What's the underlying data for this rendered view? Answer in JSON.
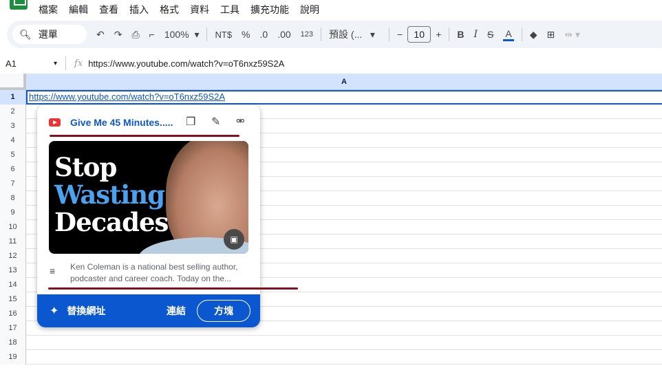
{
  "menu": [
    "檔案",
    "編輯",
    "查看",
    "插入",
    "格式",
    "資料",
    "工具",
    "擴充功能",
    "說明"
  ],
  "toolbar": {
    "search": "選單",
    "zoom": "100%",
    "currency": "NT$",
    "percent": "%",
    "dec_less": ".0",
    "dec_more": ".00",
    "number_format": "123",
    "font": "預設 (...",
    "font_size": "10",
    "bold": "B",
    "italic": "I",
    "text_color": "A"
  },
  "formula_bar": {
    "cell_ref": "A1",
    "fx": "fx",
    "value": "https://www.youtube.com/watch?v=oT6nxz59S2A"
  },
  "grid": {
    "column": "A",
    "rows": [
      "1",
      "2",
      "3",
      "4",
      "5",
      "6",
      "7",
      "8",
      "9",
      "10",
      "11",
      "12",
      "13",
      "14",
      "15",
      "16",
      "17",
      "18",
      "19"
    ],
    "a1": "https://www.youtube.com/watch?v=oT6nxz59S2A"
  },
  "card": {
    "title": "Give Me 45 Minutes.....",
    "thumb_lines": [
      "Stop",
      "Wasting",
      "Decades"
    ],
    "description": "Ken Coleman is a national best selling author, podcaster and career coach. Today on the...",
    "replace_url": "替換網址",
    "link": "連結",
    "chip": "方塊"
  }
}
